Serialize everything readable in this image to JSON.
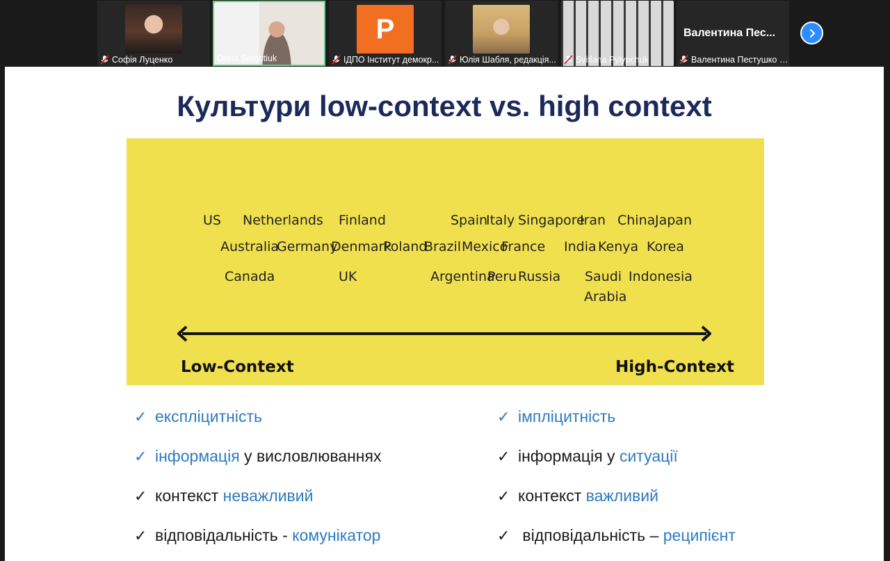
{
  "participants": [
    {
      "name": "Софія Луценко",
      "muted": true,
      "thumb": "face"
    },
    {
      "name": "Orest Semotiuk",
      "muted": false,
      "thumb": "office",
      "active": true
    },
    {
      "name": "ІДПО Інститут демокр...",
      "muted": true,
      "thumb": "letter",
      "letter": "P",
      "color": "#f26f21"
    },
    {
      "name": "Юлія Шабля, редакція...",
      "muted": true,
      "thumb": "face"
    },
    {
      "name": "Svitlana Pylypchuk",
      "muted": true,
      "thumb": "room"
    },
    {
      "name": "Валентина Пестушко (...",
      "muted": true,
      "thumb": "text",
      "big_name": "Валентина Пес..."
    }
  ],
  "next_icon": "chevron-right-icon",
  "slide": {
    "title": "Культури low-context vs. high context",
    "countries": {
      "row1": [
        "US",
        "Netherlands",
        "Finland",
        "Spain",
        "Italy",
        "Singapore",
        "Iran",
        "China",
        "Japan"
      ],
      "row2": [
        "Australia",
        "Germany",
        "Denmark",
        "Poland",
        "Brazil",
        "Mexico",
        "France",
        "India",
        "Kenya",
        "Korea"
      ],
      "row3": [
        "Canada",
        "UK",
        "Argentina",
        "Peru",
        "Russia",
        "Saudi",
        "Arabia",
        "Indonesia"
      ]
    },
    "low_label": "Low-Context",
    "high_label": "High-Context",
    "left": [
      {
        "check": "blue",
        "parts": [
          {
            "t": "експліцитність",
            "blue": true
          }
        ]
      },
      {
        "check": "blue",
        "parts": [
          {
            "t": "інформація",
            "blue": true
          },
          {
            "t": " у висловлюваннях",
            "blue": false
          }
        ]
      },
      {
        "check": "black",
        "parts": [
          {
            "t": "контекст ",
            "blue": false
          },
          {
            "t": "неважливий",
            "blue": true
          }
        ]
      },
      {
        "check": "black",
        "parts": [
          {
            "t": "відповідальність - ",
            "blue": false
          },
          {
            "t": "комунікатор",
            "blue": true
          }
        ]
      }
    ],
    "right": [
      {
        "check": "blue",
        "parts": [
          {
            "t": "імпліцитність",
            "blue": true
          }
        ]
      },
      {
        "check": "black",
        "parts": [
          {
            "t": "інформація у ",
            "blue": false
          },
          {
            "t": "ситуації",
            "blue": true
          }
        ]
      },
      {
        "check": "black",
        "parts": [
          {
            "t": "контекст ",
            "blue": false
          },
          {
            "t": "важливий",
            "blue": true
          }
        ]
      },
      {
        "check": "black",
        "parts": [
          {
            "t": " відповідальність – ",
            "blue": false
          },
          {
            "t": "реципієнт",
            "blue": true
          }
        ]
      }
    ]
  },
  "colors": {
    "accent_blue": "#2e7ac0",
    "title_navy": "#1b2a5b",
    "band_yellow": "#f1e04e",
    "zoom_blue": "#2d8cff"
  }
}
